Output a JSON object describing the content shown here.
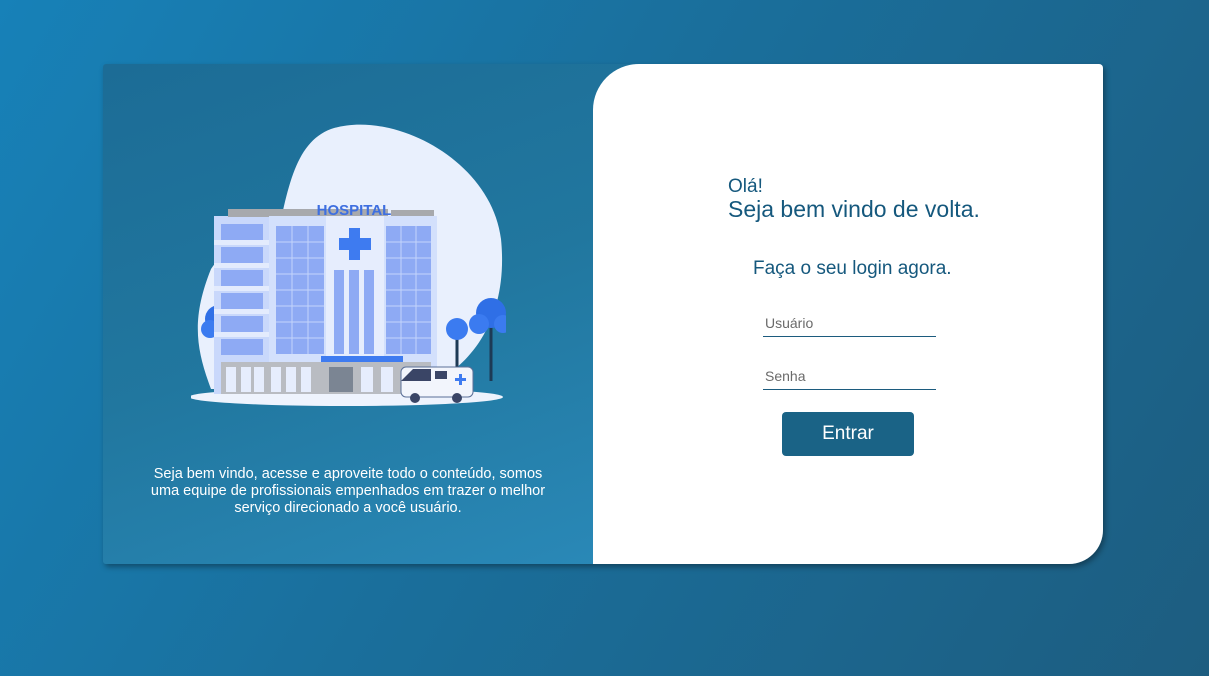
{
  "illustration": {
    "sign_text": "HOSPITAL"
  },
  "left_panel": {
    "description": "Seja bem vindo, acesse e aproveite todo o conteúdo, somos uma equipe de profissionais empenhados em trazer o melhor serviço direcionado a você usuário."
  },
  "login": {
    "hello": "Olá!",
    "welcome_back": "Seja bem vindo de volta.",
    "title": "Faça o seu login agora.",
    "username_placeholder": "Usuário",
    "password_placeholder": "Senha",
    "submit_label": "Entrar"
  },
  "colors": {
    "background": "#1a6f9c",
    "panel_left": "#21779f",
    "primary": "#1a6386",
    "heading_text": "#15587d"
  }
}
